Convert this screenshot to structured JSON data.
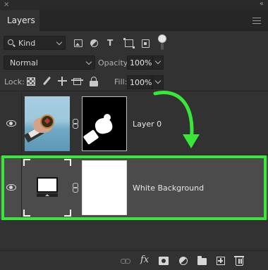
{
  "window": {
    "close_glyph": "×",
    "collapse_glyph": "«"
  },
  "tab": {
    "label": "Layers"
  },
  "filter": {
    "kind_label": "Kind"
  },
  "blend": {
    "mode": "Normal",
    "opacity_label": "Opacity:",
    "opacity_value": "100%"
  },
  "lock": {
    "label": "Lock:",
    "fill_label": "Fill:",
    "fill_value": "100%"
  },
  "layers": [
    {
      "name": "Layer 0",
      "selected": false
    },
    {
      "name": "White Background",
      "selected": true
    }
  ],
  "bottom": {
    "fx_label": "fx"
  },
  "colors": {
    "highlight": "#3be63b",
    "arrow": "#3be63b",
    "selected_row": "#4b4b4b"
  }
}
